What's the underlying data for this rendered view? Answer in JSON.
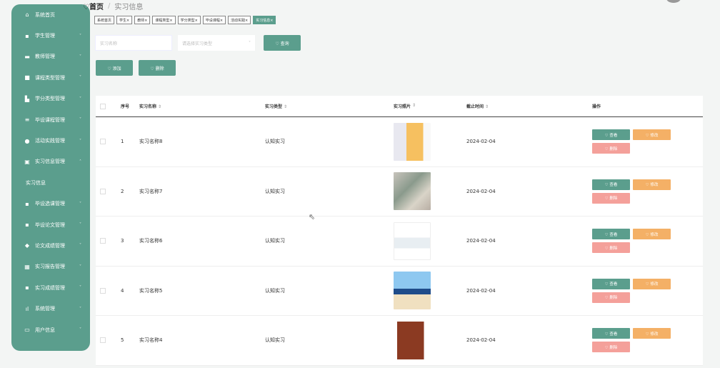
{
  "sidebar": {
    "items": [
      {
        "icon": "⌂",
        "icon_name": "home-icon",
        "label": "系统首页",
        "chev": ""
      },
      {
        "icon": "▪",
        "icon_name": "grid-icon",
        "label": "学生管理",
        "chev": "˅"
      },
      {
        "icon": "▬",
        "icon_name": "briefcase-icon",
        "label": "教师管理",
        "chev": "˅"
      },
      {
        "icon": "■",
        "icon_name": "folder-icon",
        "label": "课程类型管理",
        "chev": "˅"
      },
      {
        "icon": "▙",
        "icon_name": "chart-icon",
        "label": "学分类型管理",
        "chev": "˅"
      },
      {
        "icon": "≡",
        "icon_name": "list-icon",
        "label": "毕设课程管理",
        "chev": "˅"
      },
      {
        "icon": "●",
        "icon_name": "chat-icon",
        "label": "活动实践管理",
        "chev": "˅"
      },
      {
        "icon": "▣",
        "icon_name": "file-icon",
        "label": "实习信息管理",
        "chev": "˄"
      },
      {
        "icon": "",
        "icon_name": "",
        "label": "实习信息",
        "chev": "",
        "sub": true
      },
      {
        "icon": "▪",
        "icon_name": "grid-icon",
        "label": "毕设选课管理",
        "chev": "˅"
      },
      {
        "icon": "▪",
        "icon_name": "grid-icon",
        "label": "毕设论文管理",
        "chev": "˅"
      },
      {
        "icon": "◆",
        "icon_name": "pin-icon",
        "label": "论文成绩管理",
        "chev": "˅"
      },
      {
        "icon": "▦",
        "icon_name": "table-icon",
        "label": "实习报告管理",
        "chev": "˅"
      },
      {
        "icon": "▪",
        "icon_name": "grid-icon",
        "label": "实习成绩管理",
        "chev": "˅"
      },
      {
        "icon": "ıl",
        "icon_name": "bar-chart-icon",
        "label": "系统管理",
        "chev": "˅"
      },
      {
        "icon": "▭",
        "icon_name": "user-card-icon",
        "label": "用户信息",
        "chev": "˅"
      }
    ]
  },
  "breadcrumb": {
    "home": "♡首页",
    "sep": "/",
    "current": "实习信息"
  },
  "tags": [
    "系统首页",
    "学生×",
    "教师×",
    "课程类型×",
    "学分类型×",
    "毕设课程×",
    "活动实践×",
    "实习信息×"
  ],
  "search": {
    "name_placeholder": "实习名称",
    "type_placeholder": "请选择实习类型",
    "query_label": "♡ 查询"
  },
  "actions": {
    "add_label": "♡ 添加",
    "delete_label": "♡ 删除"
  },
  "table": {
    "headers": {
      "no": "序号",
      "name": "实习名称",
      "type": "实习类型",
      "photo": "实习照片",
      "end": "截止时间",
      "ops": "操作"
    },
    "sort_mark": "⇕",
    "rows": [
      {
        "no": "1",
        "name": "实习名称8",
        "type": "认知实习",
        "end": "2024-02-04"
      },
      {
        "no": "2",
        "name": "实习名称7",
        "type": "认知实习",
        "end": "2024-02-04"
      },
      {
        "no": "3",
        "name": "实习名称6",
        "type": "认知实习",
        "end": "2024-02-04"
      },
      {
        "no": "4",
        "name": "实习名称5",
        "type": "认知实习",
        "end": "2024-02-04"
      },
      {
        "no": "5",
        "name": "实习名称4",
        "type": "认知实习",
        "end": "2024-02-04"
      }
    ],
    "op_labels": {
      "view": "♡ 查看",
      "edit": "♡ 修改",
      "delete": "♡ 删除"
    }
  },
  "colors": {
    "primary": "#5b9e8d",
    "edit": "#f4b066",
    "delete": "#f4a09a"
  }
}
